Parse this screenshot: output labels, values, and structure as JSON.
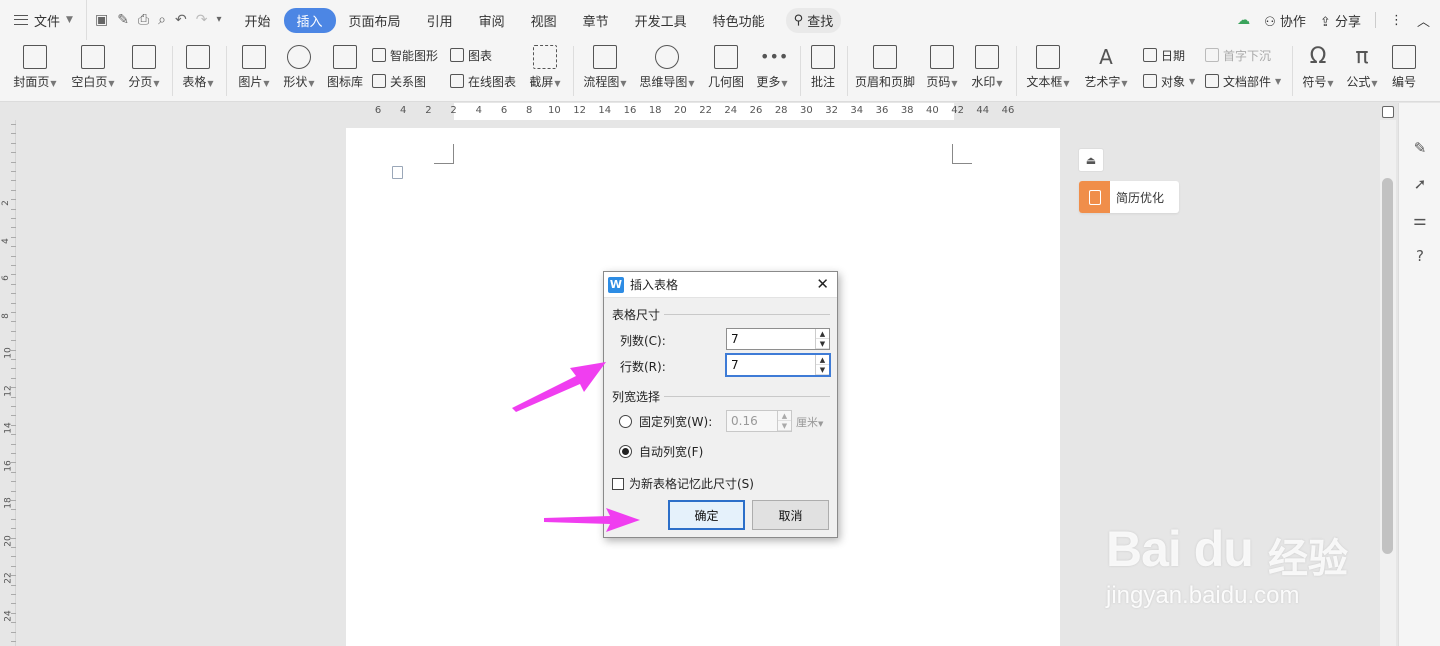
{
  "menubar": {
    "file_label": "文件",
    "tabs": [
      {
        "label": "开始"
      },
      {
        "label": "插入",
        "active": true
      },
      {
        "label": "页面布局"
      },
      {
        "label": "引用"
      },
      {
        "label": "审阅"
      },
      {
        "label": "视图"
      },
      {
        "label": "章节"
      },
      {
        "label": "开发工具"
      },
      {
        "label": "特色功能"
      }
    ],
    "search_label": "查找",
    "collab_label": "协作",
    "share_label": "分享",
    "active_tab_color": "#4c86e4"
  },
  "ribbon": {
    "cover_page": "封面页",
    "blank_page": "空白页",
    "page_break": "分页",
    "table": "表格",
    "picture": "图片",
    "shape": "形状",
    "icon_lib": "图标库",
    "smart_art": "智能图形",
    "chart": "图表",
    "relation": "关系图",
    "online_chart": "在线图表",
    "screenshot": "截屏",
    "flowchart": "流程图",
    "mindmap": "思维导图",
    "geometry": "几何图",
    "more": "更多",
    "comment": "批注",
    "header_footer": "页眉和页脚",
    "page_number": "页码",
    "watermark": "水印",
    "textbox": "文本框",
    "wordart": "艺术字",
    "date": "日期",
    "object": "对象",
    "drop_cap": "首字下沉",
    "doc_parts": "文档部件",
    "symbol": "符号",
    "formula": "公式",
    "numbering": "编号"
  },
  "ruler": {
    "h_ticks": [
      "6",
      "4",
      "2",
      "2",
      "4",
      "6",
      "8",
      "10",
      "12",
      "14",
      "16",
      "18",
      "20",
      "22",
      "24",
      "26",
      "28",
      "30",
      "32",
      "34",
      "36",
      "38",
      "40",
      "42",
      "44",
      "46"
    ],
    "v_ticks": [
      "2",
      "4",
      "6",
      "8",
      "10",
      "12",
      "14",
      "16",
      "18",
      "20",
      "22",
      "24"
    ]
  },
  "side": {
    "resume_label": "简历优化",
    "resume_color": "#f08e4a"
  },
  "dialog": {
    "title": "插入表格",
    "size_group": "表格尺寸",
    "cols_label": "列数(C):",
    "cols_value": "7",
    "rows_label": "行数(R):",
    "rows_value": "7",
    "width_group": "列宽选择",
    "fixed_label": "固定列宽(W):",
    "fixed_value": "0.16",
    "fixed_unit": "厘米",
    "auto_label": "自动列宽(F)",
    "remember_label": "为新表格记忆此尺寸(S)",
    "ok_label": "确定",
    "cancel_label": "取消"
  },
  "annotation": {
    "arrow_color": "#f03ef0"
  },
  "watermark": {
    "brand": "Bai du",
    "cn": "经验",
    "url": "jingyan.baidu.com"
  }
}
